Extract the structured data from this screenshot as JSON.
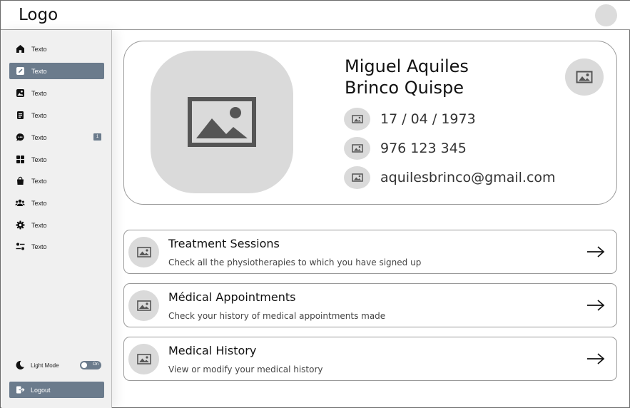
{
  "header": {
    "logo": "Logo"
  },
  "sidebar": {
    "items": [
      {
        "label": "Texto",
        "icon": "home-icon"
      },
      {
        "label": "Texto",
        "icon": "edit-icon"
      },
      {
        "label": "Texto",
        "icon": "image-icon"
      },
      {
        "label": "Texto",
        "icon": "document-icon"
      },
      {
        "label": "Texto",
        "icon": "chat-icon",
        "badge": "1"
      },
      {
        "label": "Texto",
        "icon": "grid-icon"
      },
      {
        "label": "Texto",
        "icon": "bag-icon"
      },
      {
        "label": "Texto",
        "icon": "users-icon"
      },
      {
        "label": "Texto",
        "icon": "gear-icon"
      },
      {
        "label": "Texto",
        "icon": "sliders-icon"
      }
    ],
    "active_index": 1,
    "light_mode": {
      "label": "Light Mode",
      "toggle_text": "On"
    },
    "logout_label": "Logout"
  },
  "profile": {
    "name_line1": "Miguel Aquiles",
    "name_line2": "Brinco Quispe",
    "birthdate": "17 / 04 / 1973",
    "phone": "976 123 345",
    "email": "aquilesbrinco@gmail.com"
  },
  "actions": [
    {
      "title": "Treatment Sessions",
      "subtitle": "Check all the physiotherapies to which you have signed up"
    },
    {
      "title": "Médical Appointments",
      "subtitle": "Check your history of medical appointments made"
    },
    {
      "title": "Medical History",
      "subtitle": "View or modify your medical history"
    }
  ],
  "colors": {
    "accent": "#6b7b8c",
    "placeholder": "#dadada",
    "sidebar_bg": "#f0f0f0"
  }
}
